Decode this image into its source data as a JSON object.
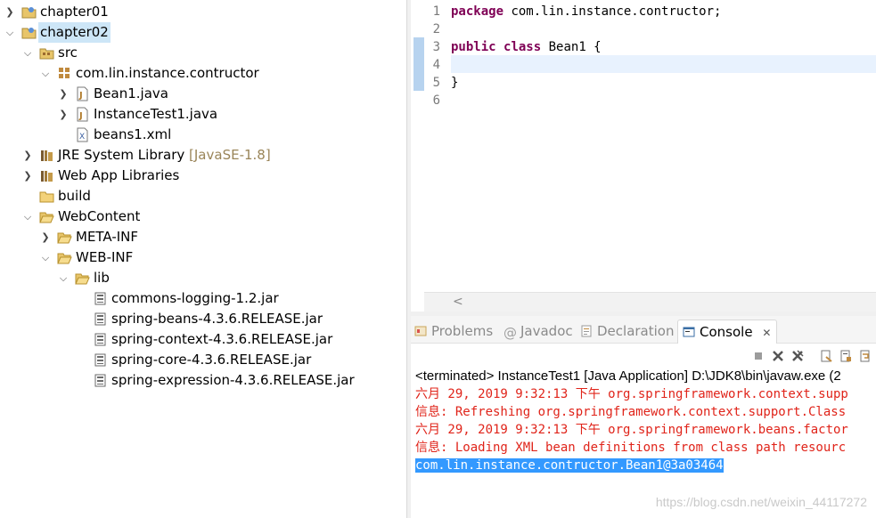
{
  "tree": {
    "items": [
      {
        "label": "chapter01",
        "icon": "java-project-icon"
      },
      {
        "label": "chapter02",
        "icon": "java-project-icon"
      },
      {
        "label": "src",
        "icon": "source-folder-icon"
      },
      {
        "label": "com.lin.instance.contructor",
        "icon": "package-icon"
      },
      {
        "label": "Bean1.java",
        "icon": "java-file-icon"
      },
      {
        "label": "InstanceTest1.java",
        "icon": "java-file-icon"
      },
      {
        "label": "beans1.xml",
        "icon": "xml-file-icon"
      },
      {
        "label": "JRE System Library",
        "decoration": "[JavaSE-1.8]",
        "icon": "library-icon"
      },
      {
        "label": "Web App Libraries",
        "icon": "library-icon"
      },
      {
        "label": "build",
        "icon": "folder-icon"
      },
      {
        "label": "WebContent",
        "icon": "folder-open-icon"
      },
      {
        "label": "META-INF",
        "icon": "folder-icon"
      },
      {
        "label": "WEB-INF",
        "icon": "folder-open-icon"
      },
      {
        "label": "lib",
        "icon": "folder-open-icon"
      },
      {
        "label": "commons-logging-1.2.jar",
        "icon": "jar-icon"
      },
      {
        "label": "spring-beans-4.3.6.RELEASE.jar",
        "icon": "jar-icon"
      },
      {
        "label": "spring-context-4.3.6.RELEASE.jar",
        "icon": "jar-icon"
      },
      {
        "label": "spring-core-4.3.6.RELEASE.jar",
        "icon": "jar-icon"
      },
      {
        "label": "spring-expression-4.3.6.RELEASE.jar",
        "icon": "jar-icon"
      }
    ]
  },
  "editor": {
    "line_numbers": [
      "1",
      "2",
      "3",
      "4",
      "5",
      "6"
    ],
    "line1_kw": "package",
    "line1_rest": " com.lin.instance.contructor;",
    "line3_kw1": "public",
    "line3_kw2": "class",
    "line3_rest": " Bean1 {",
    "line5": "}",
    "scroll_left": "<"
  },
  "tabs": {
    "problems": "Problems",
    "javadoc": "Javadoc",
    "declaration": "Declaration",
    "console": "Console",
    "close": "✕"
  },
  "console": {
    "header": "<terminated> InstanceTest1 [Java Application] D:\\JDK8\\bin\\javaw.exe (2",
    "lines": [
      "六月 29, 2019 9:32:13 下午 org.springframework.context.supp",
      "信息: Refreshing org.springframework.context.support.Class",
      "六月 29, 2019 9:32:13 下午 org.springframework.beans.factor",
      "信息: Loading XML bean definitions from class path resourc"
    ],
    "output": "com.lin.instance.contructor.Bean1@3a03464"
  },
  "watermark": "https://blog.csdn.net/weixin_44117272",
  "colors": {
    "keyword": "#7f0055",
    "error_text": "#e0241a",
    "selection": "#3399ff"
  }
}
